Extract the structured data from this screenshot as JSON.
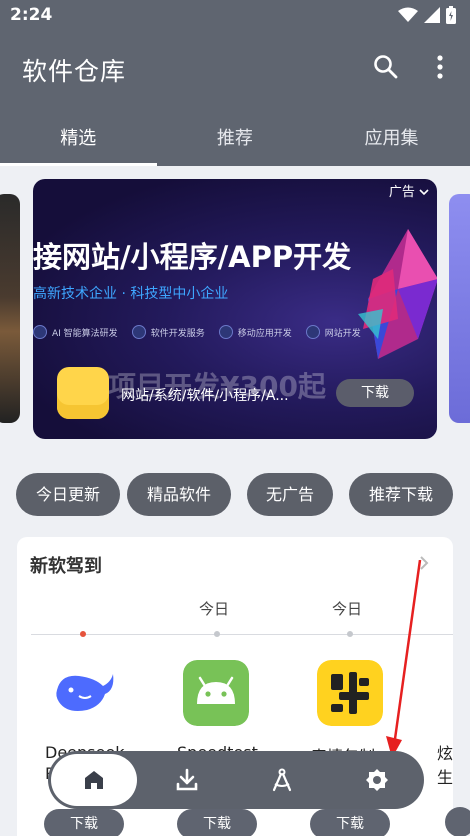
{
  "status_bar": {
    "time": "2:24",
    "icons": [
      "wifi-icon",
      "signal-icon",
      "battery-icon"
    ]
  },
  "toolbar": {
    "title": "软件仓库",
    "icons": [
      "search-icon",
      "more-vert-icon"
    ]
  },
  "tabs": [
    {
      "label": "精选",
      "active": true
    },
    {
      "label": "推荐",
      "active": false
    },
    {
      "label": "应用集",
      "active": false
    }
  ],
  "banner": {
    "ad_label": "广告",
    "headline": "接网站/小程序/APP开发",
    "subheadline": "高新技术企业 · 科技型中小企业",
    "features": [
      "AI 智能算法研发",
      "软件开发服务",
      "移动应用开发",
      "网站开发"
    ],
    "price_text": "项目开发¥300起",
    "app_name": "网站/系统/软件/小程序/A...",
    "download_label": "下载"
  },
  "filters": [
    "今日更新",
    "精品软件",
    "无广告",
    "推荐下载"
  ],
  "new_arrivals": {
    "title": "新软驾到",
    "days": [
      "今日",
      "今日"
    ],
    "apps": [
      {
        "name_line1": "Deepseek",
        "name_line2": "R...",
        "icon": "deepseek-whale-icon",
        "download": "下载"
      },
      {
        "name_line1": "Speedtest",
        "name_line2": "",
        "icon": "android-icon",
        "download": "下载"
      },
      {
        "name_line1": "表情包制",
        "name_line2": "",
        "icon": "emoji-maker-icon",
        "download": "下载"
      }
    ],
    "peek_app": {
      "name_line1": "炫",
      "name_line2": "生"
    }
  },
  "bottom_nav": [
    "home-icon",
    "download-icon",
    "compass-icon",
    "settings-icon"
  ],
  "colors": {
    "header": "#5f6570",
    "chip": "#5c6069",
    "accent_red": "#e6533c",
    "deepseek_blue": "#4d6bfe",
    "android_green": "#78c257",
    "emoji_yellow": "#ffd21f"
  }
}
